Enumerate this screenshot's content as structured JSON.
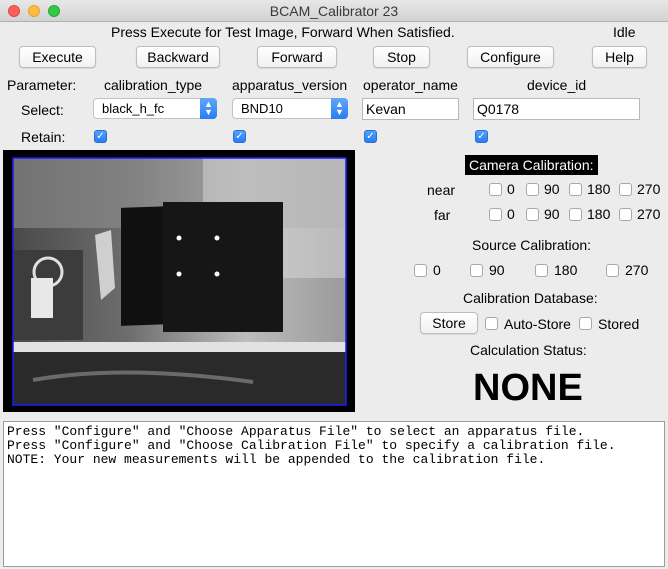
{
  "window": {
    "title": "BCAM_Calibrator 23"
  },
  "status": {
    "message": "Press Execute for Test Image, Forward When Satisfied.",
    "state": "Idle"
  },
  "toolbar": {
    "execute_label": "Execute",
    "backward_label": "Backward",
    "forward_label": "Forward",
    "stop_label": "Stop",
    "configure_label": "Configure",
    "help_label": "Help"
  },
  "params": {
    "parameter_label": "Parameter:",
    "select_label": "Select:",
    "retain_label": "Retain:",
    "columns": [
      {
        "name": "calibration_type",
        "value": "black_h_fc",
        "retain": true
      },
      {
        "name": "apparatus_version",
        "value": "BND10",
        "retain": true
      },
      {
        "name": "operator_name",
        "value": "Kevan",
        "retain": true
      },
      {
        "name": "device_id",
        "value": "Q0178",
        "retain": true
      }
    ]
  },
  "camera_calibration": {
    "title": "Camera Calibration:",
    "rows": [
      {
        "label": "near",
        "options": [
          "0",
          "90",
          "180",
          "270"
        ]
      },
      {
        "label": "far",
        "options": [
          "0",
          "90",
          "180",
          "270"
        ]
      }
    ]
  },
  "source_calibration": {
    "title": "Source Calibration:",
    "options": [
      "0",
      "90",
      "180",
      "270"
    ]
  },
  "calibration_database": {
    "title": "Calibration Database:",
    "store_label": "Store",
    "auto_store_label": "Auto-Store",
    "stored_label": "Stored"
  },
  "calculation_status": {
    "title": "Calculation Status:",
    "value": "NONE"
  },
  "log": {
    "text": "Press \"Configure\" and \"Choose Apparatus File\" to select an apparatus file.\nPress \"Configure\" and \"Choose Calibration File\" to specify a calibration file.\nNOTE: Your new measurements will be appended to the calibration file."
  },
  "colors": {
    "accent": "#2a7cf2",
    "image_border": "#1a1aff"
  }
}
